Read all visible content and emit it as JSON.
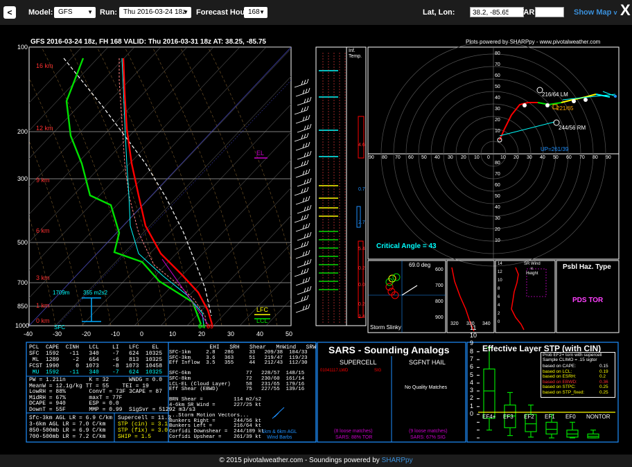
{
  "topbar": {
    "model_label": "Model:",
    "model": "GFS",
    "run_label": "Run:",
    "run": "Thu 2016-03-24 18z",
    "fh_label": "Forecast Hour:",
    "fh": "168",
    "latlon_label": "Lat, Lon:",
    "latlon": "38.2, -85.65",
    "metar_label": "METAR:",
    "metar": "",
    "showmap": "Show Map",
    "close": "X"
  },
  "header": {
    "title": "GFS 2016-03-24 18z, FH 168   VALID: Thu 2016-03-31 18z   AT: 38.25, -85.75",
    "credit": "Plots powered by SHARPpy - www.pivotalweather.com"
  },
  "skewt": {
    "heights": [
      "16 km",
      "12 km",
      "9 km",
      "6 km",
      "3 km",
      "1 km",
      "0 km"
    ],
    "pressures": [
      "100",
      "200",
      "300",
      "500",
      "700",
      "850",
      "1000"
    ],
    "temps": [
      "-40",
      "-30",
      "-20",
      "-10",
      "0",
      "10",
      "20",
      "30",
      "40",
      "50"
    ],
    "el": "EL",
    "lfc": "LFC",
    "lcl": "LCL",
    "sfc": "SFC",
    "depth": "1709m",
    "srh": "355 m2s2",
    "sfc_t": "69",
    "sfc_td": "64"
  },
  "inflow": {
    "title": "Inf.\nTemp.",
    "vals": [
      "4.6",
      "0.7",
      "2.7",
      "5.4",
      "0.2",
      "0.0",
      "0.2",
      "2.4"
    ]
  },
  "hodo": {
    "lm": "216/64 LM",
    "mean": "221/65",
    "rm": "244/56 RM",
    "up": "UP=261/39",
    "critical": "Critical Angle = 43",
    "rings": [
      "80",
      "70",
      "60",
      "50",
      "40",
      "30",
      "20",
      "10"
    ],
    "ticks": [
      "90",
      "80",
      "70",
      "60",
      "50",
      "40",
      "30",
      "20",
      "10",
      "0",
      "10",
      "20",
      "30",
      "40",
      "50",
      "60",
      "70",
      "80",
      "90"
    ]
  },
  "slinky": {
    "deg": "69.0 deg",
    "label": "Storm Slinky"
  },
  "theta": {
    "p": [
      "600",
      "700",
      "800",
      "900"
    ],
    "x": [
      "320",
      "330",
      "340"
    ]
  },
  "srwind": {
    "title": "SR Wind\nv.\nHeight",
    "km": [
      "14",
      "12",
      "10",
      "8",
      "6",
      "4",
      "2",
      "0"
    ]
  },
  "haz": {
    "title": "Psbl Haz. Type",
    "value": "PDS TOR"
  },
  "thermo": {
    "hdr": "PCL  CAPE  CINH   LCL    LI   LFC    EL",
    "rows": [
      "SFC  1592   -11   340    -7   624  10325",
      " ML  1289    -2   654    -6   813  10325",
      "FCST 1990     0  1073    -8  1073  10458",
      " MU  1592   -11   340    -7   624  10325"
    ],
    "block2": [
      "PW = 1.21in       K = 32      WNDG = 0.0",
      "MeanW = 12.1g/kg TT = 55    TEI = 19",
      "LowRH = 88%       ConvT = 73F 3CAPE = 87",
      "MidRH = 67%       maxT = 77F",
      "DCAPE = 940       ESP = 0.0",
      "DownT = 55F       MMP = 0.99  SigSvr = 51292 m3/s3"
    ],
    "block3": [
      "Sfc-3km AGL LR = 6.9 C/km",
      "3-6km AGL LR = 7.0 C/km",
      "850-500mb LR = 6.9 C/km",
      "700-500mb LR = 7.2 C/km"
    ],
    "supercell": "Supercell = 11.3",
    "stp_cin": "STP (cin) = 3.1",
    "stp_fix": "STP (fix) = 3.0",
    "ship": "SHIP = 1.5"
  },
  "kin": {
    "hdr": "             EHI   SRH   Shear   MnWind   SRW",
    "rows": [
      "SFC-1km     2.8   286     33   209/38  104/33",
      "SFC-3km     3.6   363     51   219/47  119/23",
      "Eff Inflow  3.5   355     44   212/43  112/30",
      "",
      "SFC-6km                  77   228/57  148/15",
      "SFC-8km                  72   230/60  161/14",
      "LCL-EL (Cloud Layer)     58   231/65  179/16",
      "Eff Shear (EBWD)         75   227/55  139/16",
      "",
      "BRN Shear =          114 m2/s2",
      "4-6km SR Wind =      227/25 kt",
      "",
      "...Storm Motion Vectors...",
      "Bunkers Right =      244/56 kt",
      "Bunkers Left =       216/64 kt",
      "Corfidi Downshear =  244/109 kt",
      "Corfidi Upshear =    261/39 kt"
    ],
    "barbs": "1km & 6km AGL\nWind Barbs"
  },
  "sars": {
    "title": "SARS - Sounding Analogs",
    "supercell": "SUPERCELL",
    "hail": "SGFNT HAIL",
    "match": "01041117.LWD",
    "sig": "SIG",
    "nomatch": "No Quality Matches",
    "loose1": "(8 loose matches)",
    "tor": "SARS: 88% TOR",
    "loose2": "(9 loose matches)",
    "hsig": "SARS: 67% SIG"
  },
  "stp": {
    "title": "Effective Layer STP (with CIN)",
    "y": [
      "11",
      "10",
      "9",
      "8",
      "7",
      "6",
      "5",
      "4",
      "3",
      "2",
      "1",
      "0"
    ],
    "x": [
      "EF4+",
      "EF3",
      "EF2",
      "EF1",
      "EF0",
      "NONTOR"
    ],
    "legend": [
      "Prob EF2+ torn with supercell",
      "Sample CLIMO = .15 sigtor"
    ],
    "leg_rows": [
      [
        "based on CAPE:",
        "0.15"
      ],
      [
        "based on LCL:",
        "0.19"
      ],
      [
        "based on ESRH:",
        "0.2"
      ],
      [
        "based on EBWD:",
        "0.36"
      ],
      [
        "based on STPC:",
        "0.25"
      ],
      [
        "based on STP_fixed:",
        "0.25"
      ]
    ],
    "leg_colors": [
      "#fff",
      "#ffff00",
      "#ffff00",
      "#ff3030",
      "#ffff00",
      "#ffff00"
    ]
  },
  "footer": {
    "text": "© 2015 pivotalweather.com - Soundings powered by ",
    "link": "SHARPpy"
  },
  "colors": {
    "temp": "#ff0000",
    "dew": "#00e000",
    "wetbulb": "#00ffff",
    "accent": "#3a8fd9"
  }
}
